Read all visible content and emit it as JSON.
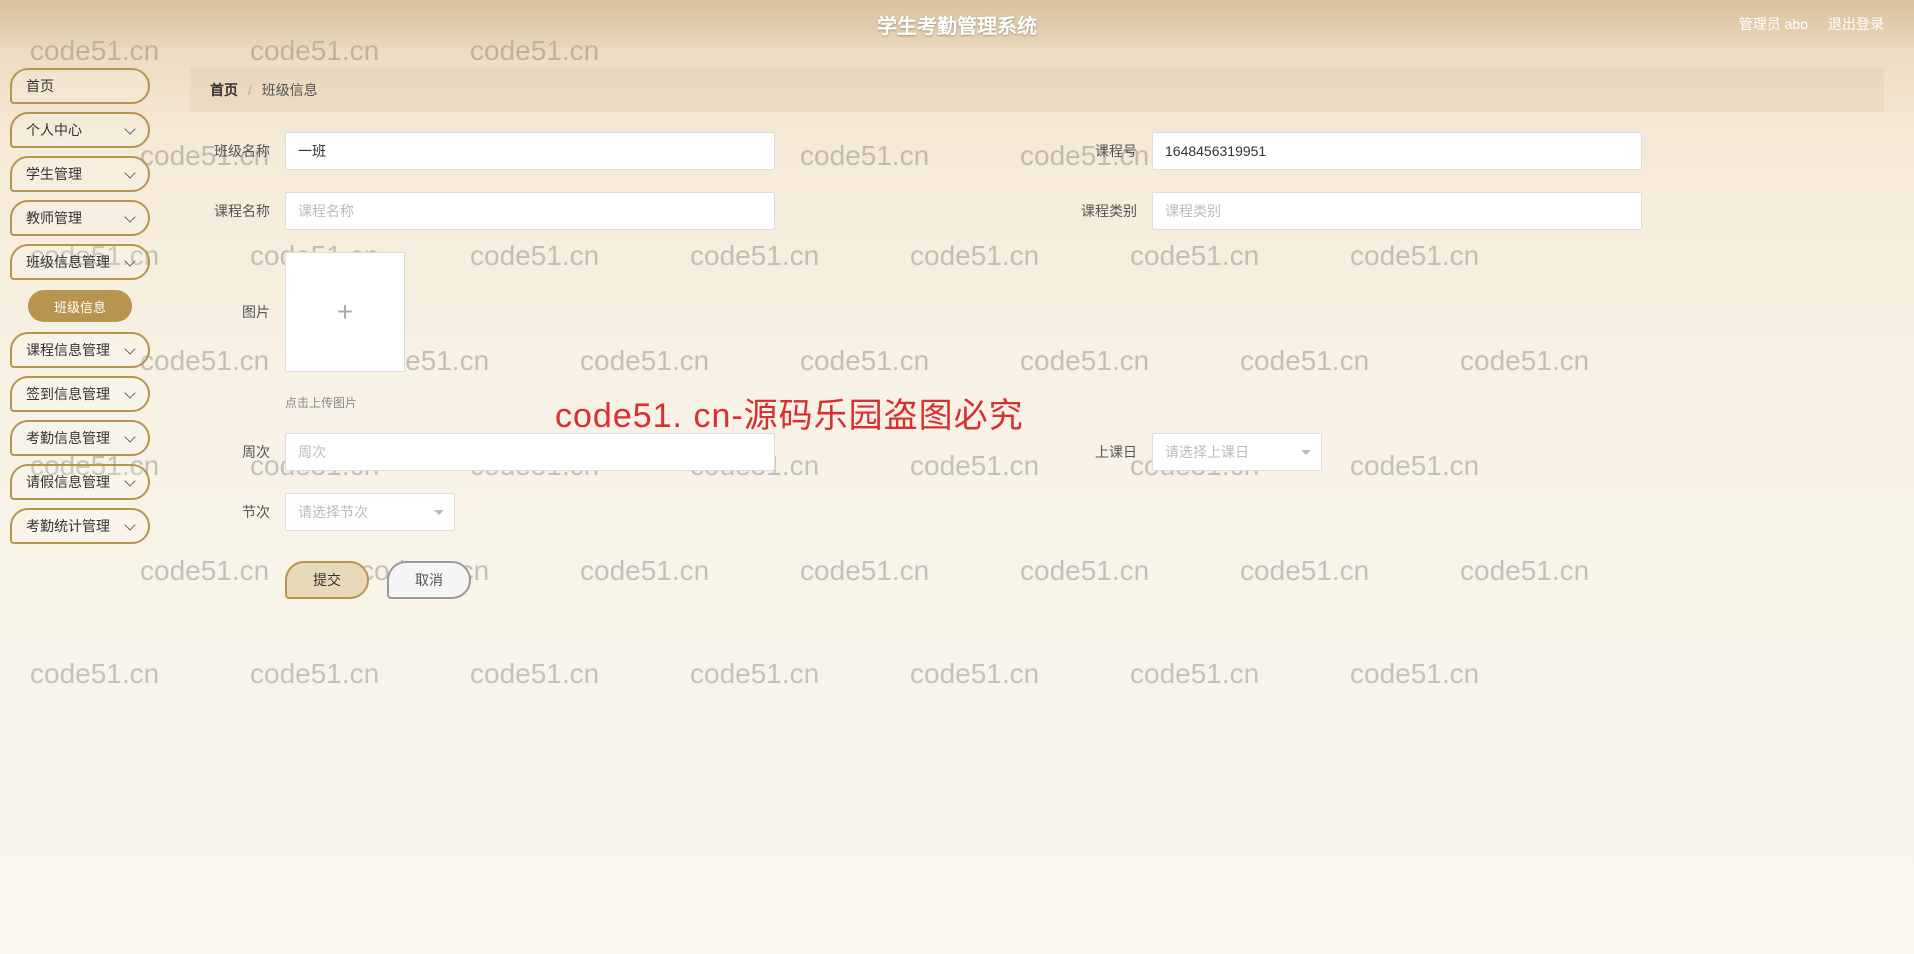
{
  "header": {
    "title": "学生考勤管理系统",
    "user_label": "管理员 abo",
    "logout": "退出登录"
  },
  "sidebar": {
    "items": [
      {
        "label": "首页",
        "expandable": false
      },
      {
        "label": "个人中心",
        "expandable": true
      },
      {
        "label": "学生管理",
        "expandable": true
      },
      {
        "label": "教师管理",
        "expandable": true
      },
      {
        "label": "班级信息管理",
        "expandable": true,
        "sub": [
          {
            "label": "班级信息"
          }
        ]
      },
      {
        "label": "课程信息管理",
        "expandable": true
      },
      {
        "label": "签到信息管理",
        "expandable": true
      },
      {
        "label": "考勤信息管理",
        "expandable": true
      },
      {
        "label": "请假信息管理",
        "expandable": true
      },
      {
        "label": "考勤统计管理",
        "expandable": true
      }
    ]
  },
  "breadcrumb": {
    "home": "首页",
    "sep": "/",
    "current": "班级信息"
  },
  "form": {
    "class_name_label": "班级名称",
    "class_name_value": "一班",
    "course_no_label": "课程号",
    "course_no_value": "1648456319951",
    "course_name_label": "课程名称",
    "course_name_placeholder": "课程名称",
    "course_type_label": "课程类别",
    "course_type_placeholder": "课程类别",
    "image_label": "图片",
    "image_hint": "点击上传图片",
    "week_label": "周次",
    "week_placeholder": "周次",
    "day_label": "上课日",
    "day_placeholder": "请选择上课日",
    "section_label": "节次",
    "section_placeholder": "请选择节次",
    "submit": "提交",
    "cancel": "取消"
  },
  "watermark_text": "code51.cn",
  "overlay": "code51. cn-源码乐园盗图必究"
}
